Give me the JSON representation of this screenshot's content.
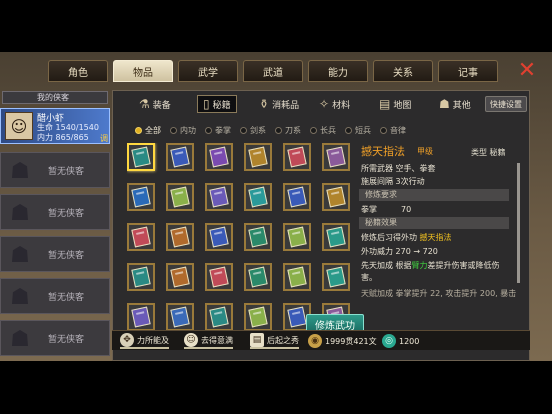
{
  "tabs": [
    {
      "label": "角色",
      "active": false
    },
    {
      "label": "物品",
      "active": true
    },
    {
      "label": "武学",
      "active": false
    },
    {
      "label": "武道",
      "active": false
    },
    {
      "label": "能力",
      "active": false
    },
    {
      "label": "关系",
      "active": false
    },
    {
      "label": "记事",
      "active": false
    }
  ],
  "left": {
    "title": "我的侠客",
    "hero": {
      "name": "醋小虾",
      "hp": "生命 1540/1540",
      "mp": "内力 865/865",
      "adjust": "调"
    },
    "empty_label": "暂无侠客",
    "empty_slots": [
      "暂无侠客",
      "暂无侠客",
      "暂无侠客",
      "暂无侠客",
      "暂无侠客"
    ]
  },
  "categories": [
    {
      "label": "装备",
      "icon": "⚗",
      "active": false
    },
    {
      "label": "秘籍",
      "icon": "▯",
      "active": true
    },
    {
      "label": "消耗品",
      "icon": "⚱",
      "active": false
    },
    {
      "label": "材料",
      "icon": "✧",
      "active": false
    },
    {
      "label": "地图",
      "icon": "▤",
      "active": false
    },
    {
      "label": "其他",
      "icon": "☗",
      "active": false
    }
  ],
  "quick_settings": "快捷设置",
  "filters": [
    {
      "label": "全部",
      "selected": true
    },
    {
      "label": "内功",
      "selected": false
    },
    {
      "label": "拳掌",
      "selected": false
    },
    {
      "label": "剑系",
      "selected": false
    },
    {
      "label": "刀系",
      "selected": false
    },
    {
      "label": "长兵",
      "selected": false
    },
    {
      "label": "短兵",
      "selected": false
    },
    {
      "label": "音律",
      "selected": false
    }
  ],
  "grid_colors": [
    "#2a8a84",
    "#3a5ab8",
    "#7a4ab0",
    "#b0842c",
    "#c04a58",
    "#8a5a9a",
    "#2a6ab8",
    "#8ab04a",
    "#6a5ab8",
    "#2a9a9a",
    "#3a5ab8",
    "#b0842c",
    "#c04a58",
    "#b06a2c",
    "#3a5ab8",
    "#2a8a6a",
    "#8ab04a",
    "#2a9a8a",
    "#2a8a84",
    "#b06a2c",
    "#c04a58",
    "#2a8a6a",
    "#8ab04a",
    "#2a9a8a",
    "#6a5ab8",
    "#3a6ab8",
    "#2a8a84",
    "#8ab04a",
    "#3a5ab8",
    "#8a5a9a"
  ],
  "detail": {
    "name": "撼天指法",
    "grade": "甲级",
    "type": "类型  秘籍",
    "weapon": "所需武器  空手、拳套",
    "cast": "施展间隔  3次行动",
    "req_head": "修炼要求",
    "req_stat": "拳掌",
    "req_value": "70",
    "effect_head": "秘籍效果",
    "effect1_a": "修炼后习得外功 ",
    "effect1_b": "撼天指法",
    "effect2": "外功威力  270 → 720",
    "effect3_a": "先天加成  根据",
    "effect3_b": "臂力",
    "effect3_c": "差提升伤害或降低伤",
    "effect3_d": "害。",
    "effect4": "天赋加成  拳掌提升 22, 攻击提升 200, 暴击",
    "train_button": "修炼武功"
  },
  "status": {
    "s1": "力所能及",
    "s2": "去得意满",
    "s3": "后起之秀",
    "money": "1999贯421文",
    "points": "1200"
  }
}
